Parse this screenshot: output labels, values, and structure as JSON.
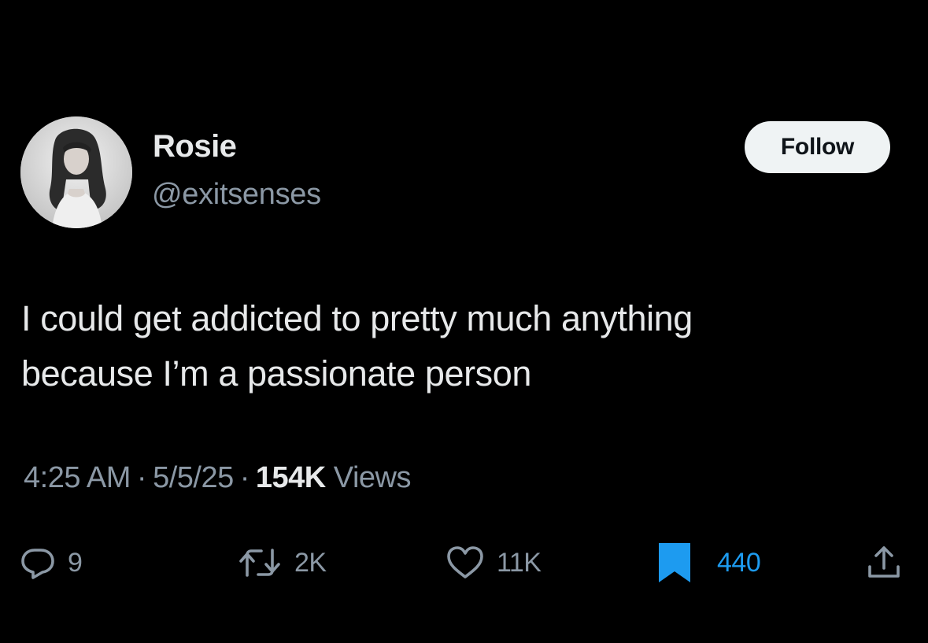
{
  "author": {
    "display_name": "Rosie",
    "handle": "@exitsenses"
  },
  "follow_button": {
    "label": "Follow"
  },
  "tweet": {
    "line1": "I could get addicted to pretty much anything",
    "line2": "because I’m a passionate person"
  },
  "meta": {
    "time": "4:25 AM",
    "date": "5/5/25",
    "views_count": "154K",
    "views_label": "Views",
    "separator": "·"
  },
  "actions": {
    "reply": {
      "icon": "reply-icon",
      "count": "9"
    },
    "retweet": {
      "icon": "retweet-icon",
      "count": "2K"
    },
    "like": {
      "icon": "heart-icon",
      "count": "11K"
    },
    "bookmark": {
      "icon": "bookmark-icon",
      "count": "440",
      "active": true
    },
    "share": {
      "icon": "share-icon"
    }
  },
  "colors": {
    "background": "#000000",
    "primary_text": "#e7e9ea",
    "secondary_text": "#8b98a5",
    "accent": "#1d9bf0",
    "follow_bg": "#eff3f4"
  }
}
